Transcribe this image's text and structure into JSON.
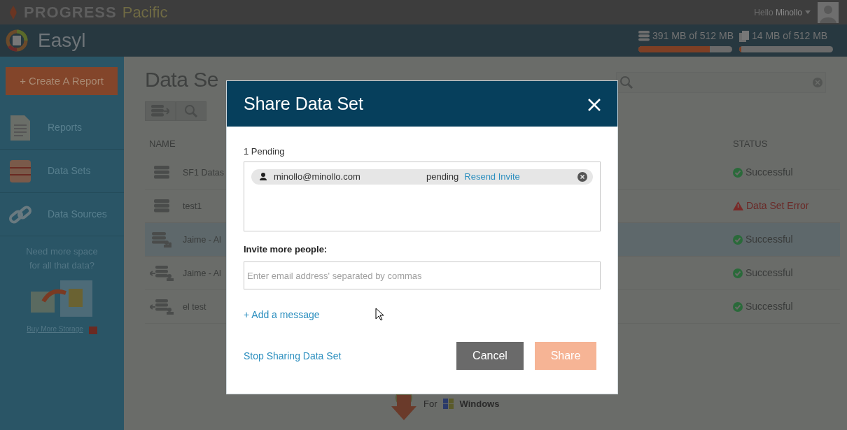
{
  "topbar": {
    "brand": "PROGRESS",
    "product": "Pacific",
    "greeting": "Hello",
    "user": "Minollo"
  },
  "appbar": {
    "name": "Easyl",
    "storage": [
      {
        "kind": "database",
        "reading": "391 MB of 512 MB",
        "level": 0.76
      },
      {
        "kind": "files",
        "reading": "14 MB of 512 MB",
        "level": 0.02
      }
    ]
  },
  "sidebar": {
    "create_button": "+ Create A Report",
    "items": [
      {
        "kind": "reports",
        "label": "Reports"
      },
      {
        "kind": "datasets",
        "label": "Data Sets"
      },
      {
        "kind": "sources",
        "label": "Data Sources"
      }
    ],
    "promo": {
      "text": "Need more space for all that data?",
      "link": "Buy More Storage"
    }
  },
  "main": {
    "title": "Data Se",
    "table": {
      "columns": [
        "NAME",
        "STATUS"
      ],
      "rows": [
        {
          "kind": "owned",
          "name": "SF1 Datas",
          "status": {
            "kind": "ok",
            "text": "Successful"
          },
          "selected": false
        },
        {
          "kind": "owned",
          "name": "test1",
          "status": {
            "kind": "error",
            "text": "Data Set Error"
          },
          "selected": false
        },
        {
          "kind": "shared",
          "name": "Jaime - Al",
          "status": {
            "kind": "ok",
            "text": "Successful"
          },
          "selected": true
        },
        {
          "kind": "received",
          "name": "Jaime - Al",
          "status": {
            "kind": "ok",
            "text": "Successful"
          },
          "selected": false
        },
        {
          "kind": "received",
          "name": "el test",
          "status": {
            "kind": "ok",
            "text": "Successful"
          },
          "selected": false
        }
      ]
    },
    "download": {
      "prefix": "For",
      "platform": "Windows"
    }
  },
  "dialog": {
    "title": "Share Data Set",
    "pending_label": "1 Pending",
    "pending": [
      {
        "email": "minollo@minollo.com",
        "status": "pending",
        "action": "Resend Invite"
      }
    ],
    "invite_label": "Invite more people:",
    "invite_placeholder": "Enter email address' separated by commas",
    "add_message": "+ Add a message",
    "stop_sharing": "Stop Sharing Data Set",
    "buttons": [
      {
        "kind": "secondary",
        "label": "Cancel",
        "disabled": false
      },
      {
        "kind": "primary",
        "label": "Share",
        "disabled": true
      }
    ]
  }
}
